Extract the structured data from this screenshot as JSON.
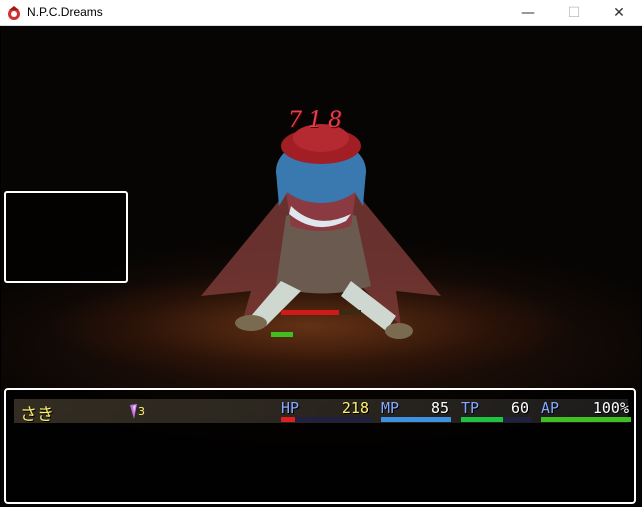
{
  "window": {
    "title": "N.P.C.Dreams",
    "min_glyph": "—",
    "max_glyph": "☐",
    "close_glyph": "✕"
  },
  "battle": {
    "damage_popup": "718",
    "enemy": {
      "hp_fraction": 0.72,
      "ap_fraction": 0.3
    },
    "actor": {
      "name": "さき",
      "state_badge": "3",
      "hp": {
        "label": "HP",
        "value": "218",
        "fraction": 0.15,
        "color": "#e02020"
      },
      "mp": {
        "label": "MP",
        "value": "85",
        "fraction": 1.0,
        "color": "#4090e0"
      },
      "tp": {
        "label": "TP",
        "value": "60",
        "fraction": 0.6,
        "color": "#20c040"
      },
      "ap": {
        "label": "AP",
        "value": "100%",
        "fraction": 1.0,
        "color": "#40c020"
      }
    }
  }
}
